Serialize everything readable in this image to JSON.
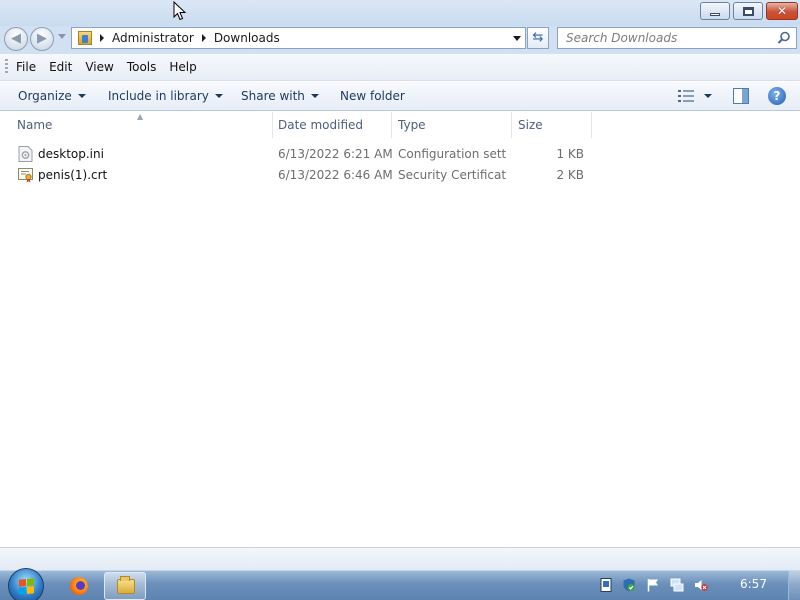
{
  "window": {
    "buttons": {
      "minimize": "minimize",
      "maximize": "restore",
      "close": "close"
    }
  },
  "address_bar": {
    "crumbs": [
      "Administrator",
      "Downloads"
    ],
    "search_placeholder": "Search Downloads"
  },
  "menu": [
    "File",
    "Edit",
    "View",
    "Tools",
    "Help"
  ],
  "toolbar": {
    "organize": "Organize",
    "include_in_library": "Include in library",
    "share_with": "Share with",
    "new_folder": "New folder"
  },
  "columns": [
    "Name",
    "Date modified",
    "Type",
    "Size"
  ],
  "files": [
    {
      "name": "desktop.ini",
      "date_modified": "6/13/2022 6:21 AM",
      "type": "Configuration sett...",
      "size": "1 KB",
      "icon": "ini-file-icon"
    },
    {
      "name": "penis(1).crt",
      "date_modified": "6/13/2022 6:46 AM",
      "type": "Security Certificate",
      "size": "2 KB",
      "icon": "certificate-file-icon"
    }
  ],
  "taskbar": {
    "items": [
      "firefox",
      "windows-explorer"
    ],
    "clock": "6:57"
  },
  "colors": {
    "title_bar": "#c9dbef",
    "taskbar": "#6a8fb9",
    "close_button": "#c8523a",
    "text_secondary": "#6d6d6d"
  }
}
